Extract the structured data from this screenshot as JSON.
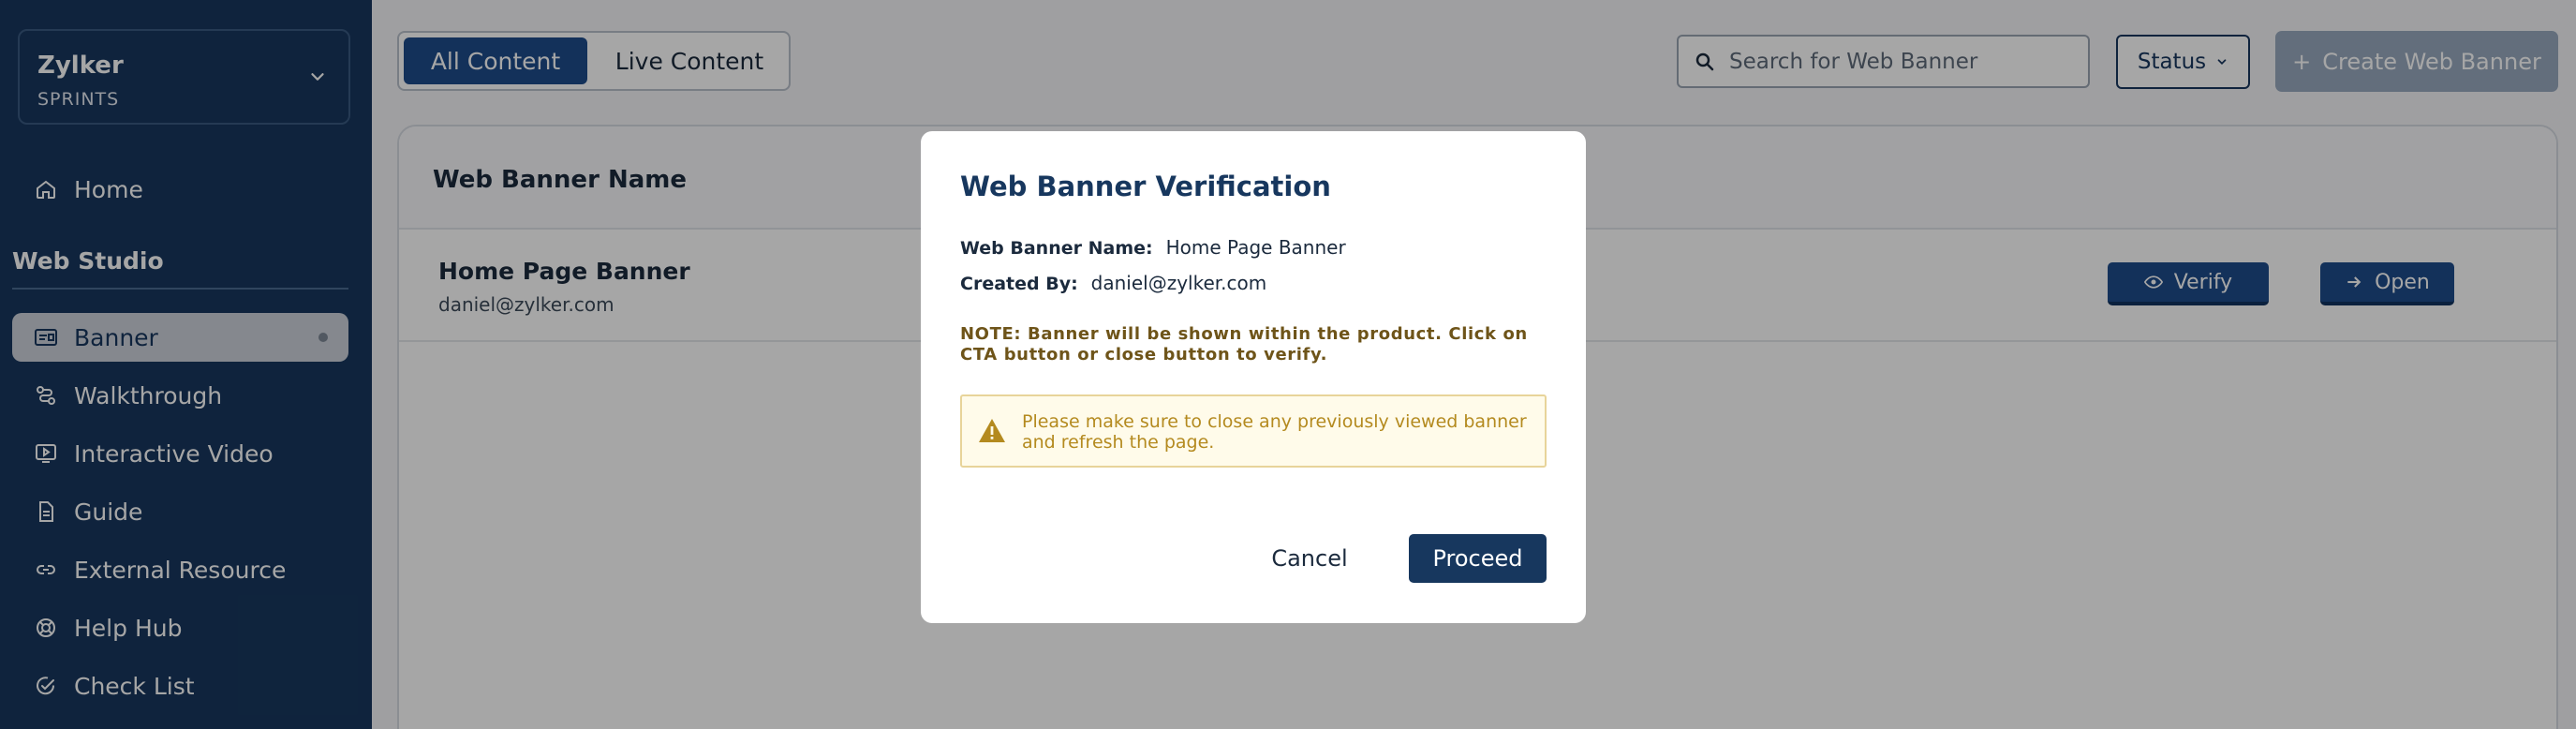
{
  "sidebar": {
    "org_name": "Zylker",
    "org_sub": "SPRINTS",
    "home": "Home",
    "section_title": "Web Studio",
    "items": [
      {
        "label": "Banner",
        "icon": "banner-icon"
      },
      {
        "label": "Walkthrough",
        "icon": "walkthrough-icon"
      },
      {
        "label": "Interactive Video",
        "icon": "video-icon"
      },
      {
        "label": "Guide",
        "icon": "guide-icon"
      },
      {
        "label": "External Resource",
        "icon": "link-icon"
      },
      {
        "label": "Help Hub",
        "icon": "lifebuoy-icon"
      },
      {
        "label": "Check List",
        "icon": "check-circle-icon"
      }
    ]
  },
  "toolbar": {
    "tab_all": "All Content",
    "tab_live": "Live Content",
    "search_placeholder": "Search for Web Banner",
    "status_label": "Status",
    "create_label": "Create Web Banner"
  },
  "table": {
    "header": "Web Banner Name",
    "rows": [
      {
        "name": "Home Page Banner",
        "email": "daniel@zylker.com",
        "verify": "Verify",
        "open": "Open"
      }
    ]
  },
  "modal": {
    "title": "Web Banner Verification",
    "name_label": "Web Banner Name:",
    "name_value": "Home Page Banner",
    "created_label": "Created By:",
    "created_value": "daniel@zylker.com",
    "note": "NOTE: Banner will be shown within the product. Click on CTA button or close button to verify.",
    "warning": "Please make sure to close any previously viewed banner and refresh the page.",
    "cancel": "Cancel",
    "proceed": "Proceed"
  },
  "colors": {
    "sidebar_bg": "#17375e",
    "accent": "#1e4c8a",
    "warning_text": "#b48a1f"
  }
}
